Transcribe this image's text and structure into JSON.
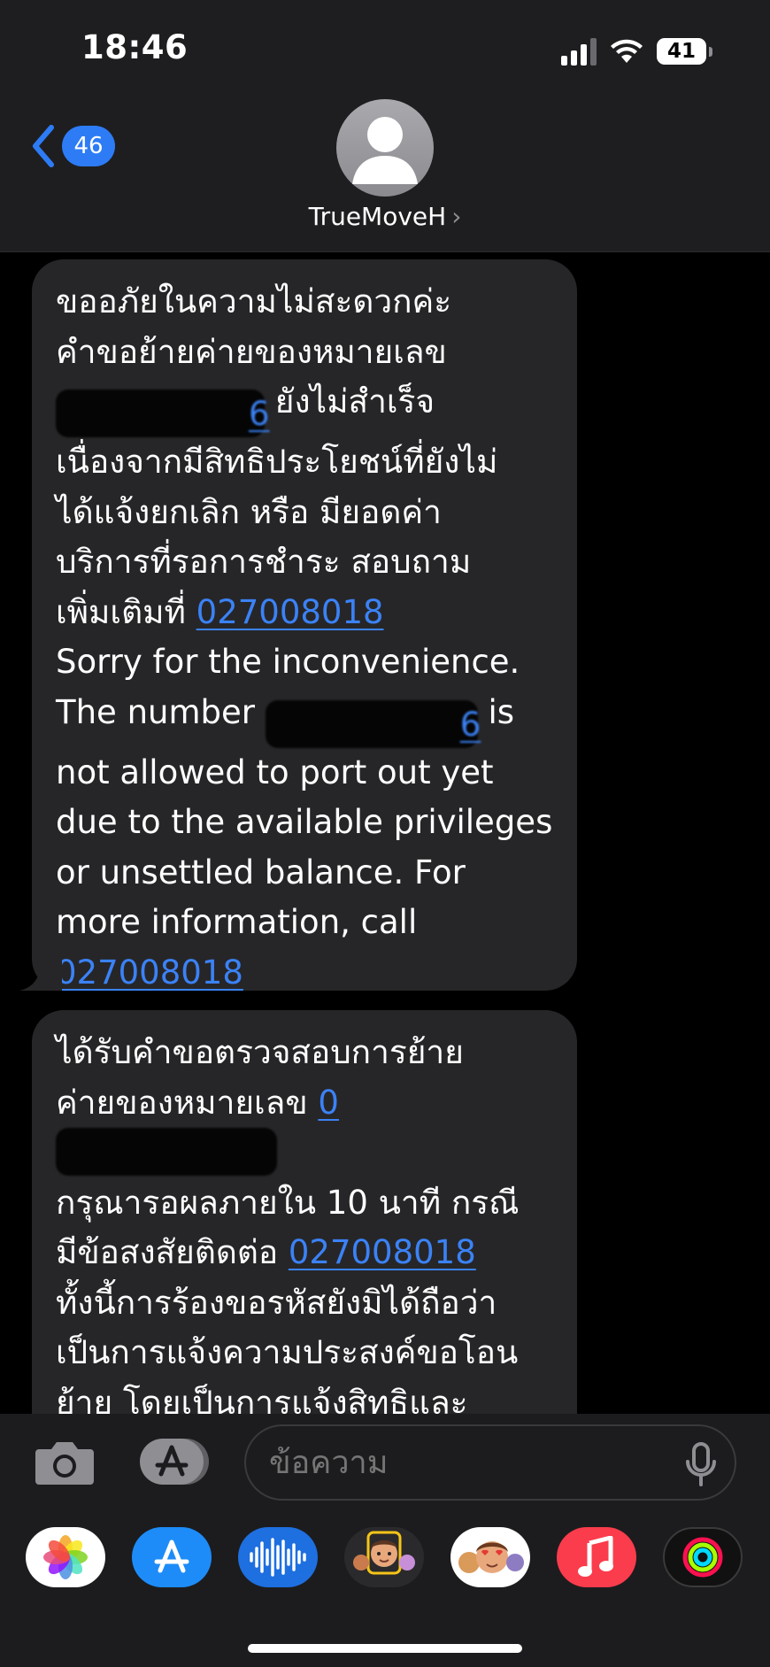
{
  "status_bar": {
    "time": "18:46",
    "battery": "41"
  },
  "nav": {
    "back_count": "46",
    "contact_name": "TrueMoveH",
    "contact_chevron": "›"
  },
  "messages": [
    {
      "th_part1": "ขออภัยในความไม่สะดวกค่ะ\nคำขอย้ายค่ายของหมายเลข\n",
      "th_redacted_visible": "6",
      "th_part2": " ยังไม่สำเร็จ\nเนื่องจากมีสิทธิประโยชน์ที่ยังไม่\nได้แจ้งยกเลิก หรือ มียอดค่า\nบริการที่รอการชำระ สอบถาม\nเพิ่มเติมที่ ",
      "phone": "027008018",
      "en_part1": "\nSorry for the inconvenience.\nThe number ",
      "en_redacted_visible": "6",
      "en_part2": " is\nnot allowed to port out yet\ndue to the available privileges\nor unsettled balance. For\nmore information, call\n",
      "phone_2": "027008018"
    },
    {
      "part1": "ได้รับคำขอตรวจสอบการย้าย\nค่ายของหมายเลข ",
      "redacted_visible": "0",
      "part2": "\nกรุณารอผลภายใน 10 นาที กรณี\nมีข้อสงสัยติดต่อ ",
      "phone": "027008018",
      "part3": "\nทั้งนี้การร้องขอรหัสยังมิได้ถือว่า\nเป็นการแจ้งความประสงค์ขอโอน\nย้าย โดยเป็นการแจ้งสิทธิและ\nตรวจสอบคุณสมบัติของผู้ใช้"
    }
  ],
  "compose": {
    "placeholder": "ข้อความ"
  },
  "app_drawer": [
    "photos-icon",
    "app-store-icon",
    "audio-message-icon",
    "memoji-stickers-icon",
    "animoji-icon",
    "music-icon",
    "fitness-activity-icon"
  ],
  "colors": {
    "link": "#3b82f6",
    "badge": "#2d7cf6",
    "bubble": "#262628",
    "music": "#fa3c4c"
  }
}
